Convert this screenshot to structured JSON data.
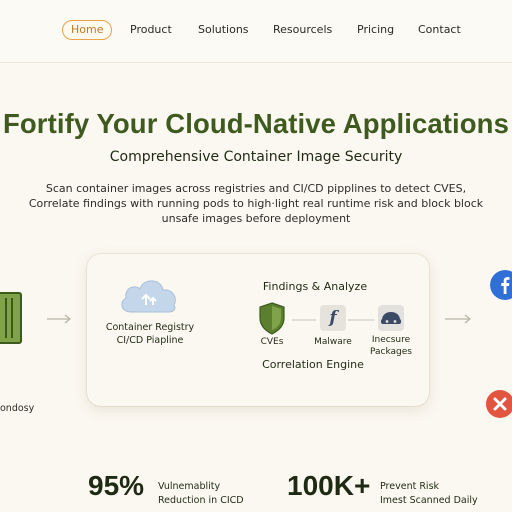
{
  "nav": {
    "items": [
      {
        "label": "Home",
        "active": true
      },
      {
        "label": "Product"
      },
      {
        "label": "Solutions"
      },
      {
        "label": "Resourcels"
      },
      {
        "label": "Pricing"
      },
      {
        "label": "Contact"
      }
    ]
  },
  "hero": {
    "title": "Fortify Your Cloud-Native Applications",
    "subtitle": "Comprehensive Container Image Security",
    "description": "Scan container images across registries and CI/CD pipplines to detect CVES, Correlate findings with running pods to high·light real runtime risk and block block unsafe images before deployment"
  },
  "flow": {
    "left_caption": "ondosy",
    "registry_label_1": "Container Registry",
    "registry_label_2": "CI/CD Piapline",
    "findings_title": "Findings & Analyze",
    "cves_label": "CVEs",
    "malware_label": "Malware",
    "insecure_label_1": "Inecsure",
    "insecure_label_2": "Packages",
    "engine_label": "Correlation Engine",
    "malware_glyph": "f"
  },
  "stats": [
    {
      "value": "95%",
      "line1": "Vulnemablity",
      "line2": "Reduction in CICD"
    },
    {
      "value": "100K+",
      "line1": "Prevent Risk",
      "line2": "Imest Scanned Daily"
    }
  ],
  "colors": {
    "accent": "#e8a24a",
    "title_green": "#3e5a1e",
    "shield_green": "#5b7f2e",
    "facebook_blue": "#2f6fd6",
    "error_red": "#e2553f"
  }
}
